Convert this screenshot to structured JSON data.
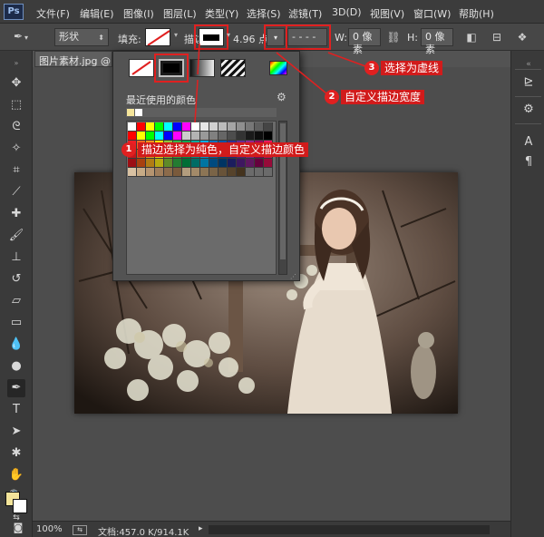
{
  "menubar": {
    "logo": "Ps",
    "items": [
      "文件(F)",
      "编辑(E)",
      "图像(I)",
      "图层(L)",
      "类型(Y)",
      "选择(S)",
      "滤镜(T)",
      "3D(D)",
      "视图(V)",
      "窗口(W)",
      "帮助(H)"
    ]
  },
  "options": {
    "tool_icon": "pen-tool-icon",
    "mode": "形状",
    "fill_label": "填充:",
    "stroke_label": "描边:",
    "stroke_width": "4.96 点",
    "line_style": "- - - -",
    "w_label": "W:",
    "w_value": "0 像素",
    "link_icon": "link-icon",
    "h_label": "H:",
    "h_value": "0 像素"
  },
  "document": {
    "tab_title": "图片素材.jpg @ 1",
    "zoom": "100%",
    "doc_size": "文档:457.0 K/914.1K"
  },
  "stroke_popup": {
    "type_buttons": [
      "none",
      "solid",
      "gradient",
      "pattern"
    ],
    "recent_label": "最近使用的颜色",
    "recent_colors": [
      "#f5e59a",
      "#ffffff"
    ],
    "swatches": [
      "#ffffff",
      "#ff0000",
      "#ffff00",
      "#00ff00",
      "#00ffff",
      "#0000ff",
      "#ff00ff",
      "#ffffff",
      "#e6e6e6",
      "#d0d0d0",
      "#bbbbbb",
      "#a5a5a5",
      "#8f8f8f",
      "#777777",
      "#5f5f5f",
      "#454545",
      "#ff0000",
      "#ffff00",
      "#00ff00",
      "#00ffff",
      "#0000ff",
      "#ff00ff",
      "#cccccc",
      "#b3b3b3",
      "#999999",
      "#808080",
      "#666666",
      "#4d4d4d",
      "#333333",
      "#1a1a1a",
      "#0d0d0d",
      "#000000",
      "#ee1d24",
      "#f26522",
      "#f7941d",
      "#fff200",
      "#8dc63f",
      "#39b54a",
      "#00a651",
      "#00a99d",
      "#00aeef",
      "#0072bc",
      "#0054a6",
      "#2e3192",
      "#662d91",
      "#92278f",
      "#9e005d",
      "#ed145b",
      "#c4161c",
      "#d25418",
      "#d9a21c",
      "#e6d617",
      "#7aaf35",
      "#2f9f41",
      "#008f46",
      "#008c82",
      "#0093cb",
      "#005e9f",
      "#004380",
      "#252878",
      "#521f7a",
      "#7d1f7c",
      "#850050",
      "#c3104a",
      "#9c0f14",
      "#a8410f",
      "#b07c14",
      "#b5aa10",
      "#5f8a28",
      "#237c31",
      "#006e36",
      "#006c65",
      "#0075a3",
      "#004a7f",
      "#003463",
      "#1b1d5e",
      "#3e1760",
      "#5f1760",
      "#66003d",
      "#970b39",
      "#d9c2a3",
      "#c7ab86",
      "#b59470",
      "#9f7d5b",
      "#8c6b4b",
      "#7a5a3c",
      "#b39d7e",
      "#a38a69",
      "#8c7555",
      "#7a6447",
      "#685339",
      "#56432b",
      "#44331e",
      "#6b6b6b",
      "#6b6b6b",
      "#6b6b6b"
    ]
  },
  "annotations": {
    "one": {
      "num": "1",
      "text": "描边选择为纯色，自定义描边颜色"
    },
    "two": {
      "num": "2",
      "text": "自定义描边宽度"
    },
    "three": {
      "num": "3",
      "text": "选择为虚线"
    }
  },
  "colors": {
    "foreground": "#f3e49a",
    "background": "#ffffff",
    "annotation_red": "#e02020"
  }
}
